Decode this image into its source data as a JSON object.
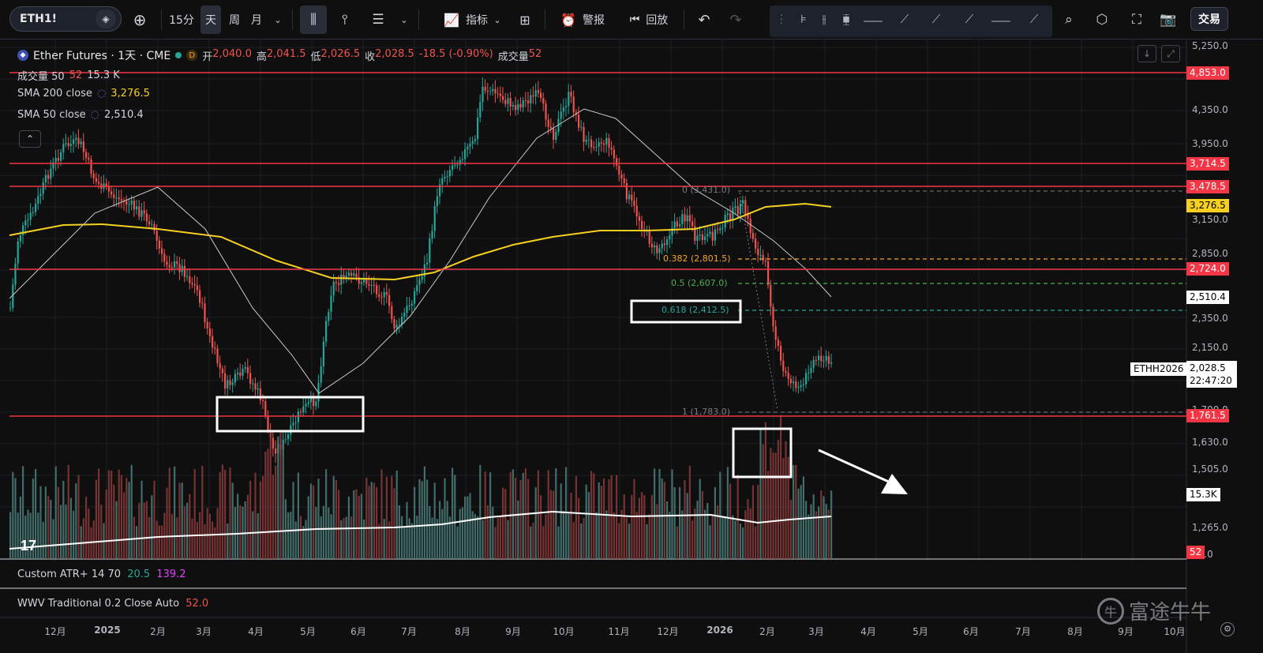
{
  "toolbar": {
    "symbol": "ETH1!",
    "intervals": [
      "15分",
      "天",
      "周",
      "月"
    ],
    "selected_interval": "天",
    "indicators_label": "指标",
    "alert_label": "警报",
    "replay_label": "回放",
    "trade_label": "交易"
  },
  "legend": {
    "instrument": "Ether Futures · 1天 · CME",
    "badge_d": "D",
    "open_label": "开",
    "open": "2,040.0",
    "high_label": "高",
    "high": "2,041.5",
    "low_label": "低",
    "low": "2,026.5",
    "close_label": "收",
    "close": "2,028.5",
    "change": "-18.5 (-0.90%)",
    "vol_label": "成交量",
    "vol": "52",
    "vol50_label": "成交量 50",
    "vol50_a": "52",
    "vol50_b": "15.3 K",
    "sma200_label": "SMA 200 close",
    "sma200": "3,276.5",
    "sma50_label": "SMA 50 close",
    "sma50": "2,510.4",
    "collapse_icon": "chevron-up-icon"
  },
  "right_axis": [
    "5,250.0",
    "4,350.0",
    "3,950.0",
    "3,150.0",
    "2,850.0",
    "2,350.0",
    "2,150.0",
    "1,700.0",
    "1,630.0",
    "1,505.0",
    "1,265.0",
    "65.0"
  ],
  "price_tags": {
    "h4853": "4,853.0",
    "h3714": "3,714.5",
    "h3478": "3,478.5",
    "sma200": "3,276.5",
    "h2724": "2,724.0",
    "sma50": "2,510.4",
    "last_symbol": "ETHH2026",
    "last": "2,028.5",
    "countdown": "22:47:20",
    "h1761": "1,761.5",
    "vol_ma": "15.3K",
    "vol": "52"
  },
  "fib": {
    "f0": "0 (3,431.0)",
    "f382": "0.382 (2,801.5)",
    "f5": "0.5 (2,607.0)",
    "f618": "0.618 (2,412.5)",
    "f1": "1 (1,783.0)"
  },
  "x_axis": [
    "12月",
    "2025",
    "2月",
    "3月",
    "4月",
    "5月",
    "6月",
    "7月",
    "8月",
    "9月",
    "10月",
    "11月",
    "12月",
    "2026",
    "2月",
    "3月",
    "4月",
    "5月",
    "6月",
    "7月",
    "8月",
    "9月",
    "10月"
  ],
  "panes": {
    "atr_label": "Custom ATR+ 14 70",
    "atr_a": "20.5",
    "atr_b": "139.2",
    "wwv_label": "WWV Traditional 0.2 Close Auto",
    "wwv_val": "52.0"
  },
  "watermark": "富途牛牛",
  "colors": {
    "up": "#26a69a",
    "down": "#ef5350",
    "hline": "#f23645",
    "sma200": "#f5d020",
    "sma50": "#c9c9c9",
    "fib382": "#f5a623",
    "fib5": "#4caf50",
    "fib618": "#26a69a"
  }
}
